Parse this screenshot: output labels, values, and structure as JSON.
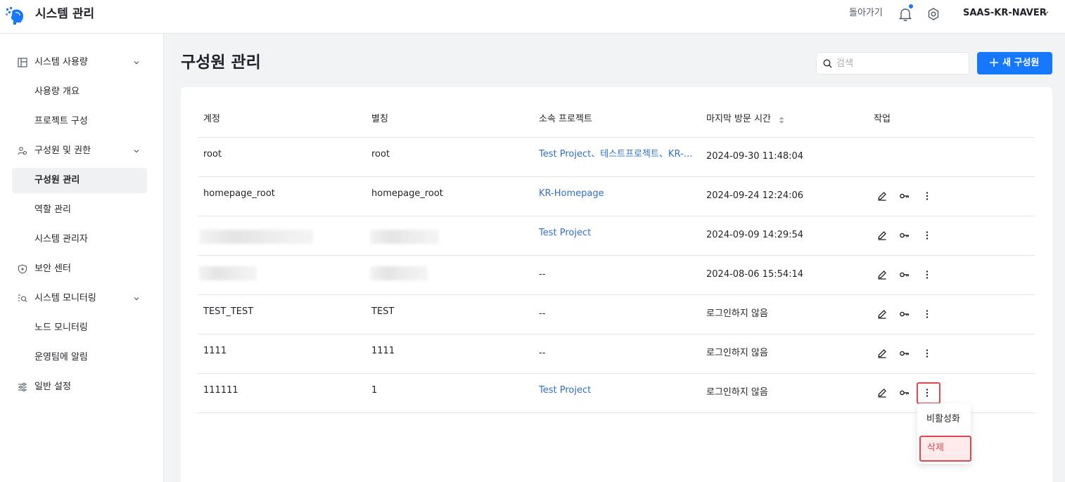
{
  "header": {
    "app_title": "시스템 관리",
    "back_label": "돌아가기",
    "tenant": "SAAS-KR-NAVER"
  },
  "sidebar": {
    "groups": [
      {
        "label": "시스템 사용량",
        "icon": "dashboard-icon",
        "items": [
          "사용량 개요",
          "프로젝트 구성"
        ]
      },
      {
        "label": "구성원 및 권한",
        "icon": "users-icon",
        "items": [
          "구성원 관리",
          "역할 관리",
          "시스템 관리자"
        ]
      },
      {
        "label": "보안 센터",
        "icon": "shield-icon",
        "items": []
      },
      {
        "label": "시스템 모니터링",
        "icon": "monitor-search-icon",
        "items": [
          "노드 모니터링",
          "운영팀에 알림"
        ]
      },
      {
        "label": "일반 설정",
        "icon": "sliders-icon",
        "items": []
      }
    ],
    "active_item": "구성원 관리"
  },
  "main": {
    "title": "구성원 관리",
    "search_placeholder": "검색",
    "new_button_label": "새 구성원",
    "columns": [
      "계정",
      "별칭",
      "소속 프로젝트",
      "마지막 방문 시간",
      "작업"
    ],
    "rows": [
      {
        "account": "root",
        "alias": "root",
        "project": "Test Project、테스트프로젝트、KR-Homepage",
        "last_visit": "2024-09-30 11:48:04",
        "actions": false
      },
      {
        "account": "homepage_root",
        "alias": "homepage_root",
        "project": "KR-Homepage",
        "last_visit": "2024-09-24 12:24:06",
        "actions": true
      },
      {
        "account": "",
        "alias": "",
        "project": "Test Project",
        "last_visit": "2024-09-09 14:29:54",
        "actions": true
      },
      {
        "account": "",
        "alias": "",
        "project": "--",
        "last_visit": "2024-08-06 15:54:14",
        "actions": true
      },
      {
        "account": "TEST_TEST",
        "alias": "TEST",
        "project": "--",
        "last_visit": "로그인하지 않음",
        "actions": true
      },
      {
        "account": "1111",
        "alias": "1111",
        "project": "--",
        "last_visit": "로그인하지 않음",
        "actions": true
      },
      {
        "account": "111111",
        "alias": "1",
        "project": "Test Project",
        "last_visit": "로그인하지 않음",
        "actions": true
      }
    ],
    "dropdown": {
      "deactivate_label": "비활성화",
      "delete_label": "삭제"
    }
  },
  "colors": {
    "accent": "#1677ff",
    "link": "#2f6fd0",
    "danger": "#e0474d"
  }
}
